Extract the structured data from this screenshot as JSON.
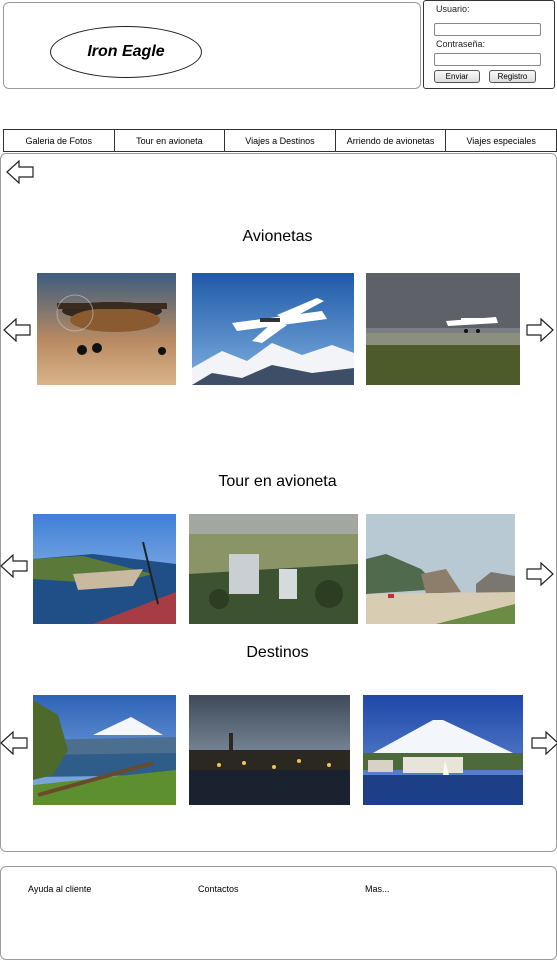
{
  "header": {
    "logo_text": "Iron Eagle"
  },
  "login": {
    "user_label": "Usuario:",
    "user_value": "",
    "password_label": "Contraseña:",
    "password_value": "",
    "submit_label": "Enviar",
    "register_label": "Registro"
  },
  "nav": {
    "items": [
      {
        "label": "Galeria de Fotos"
      },
      {
        "label": "Tour en avioneta"
      },
      {
        "label": "Viajes a Destinos"
      },
      {
        "label": "Arriendo de avionetas"
      },
      {
        "label": "Viajes especiales"
      }
    ]
  },
  "main": {
    "back_icon": "arrow-left-icon",
    "sections": [
      {
        "title": "Avionetas"
      },
      {
        "title": "Tour en avioneta"
      },
      {
        "title": "Destinos"
      }
    ]
  },
  "footer": {
    "links": [
      {
        "label": "Ayuda al cliente"
      },
      {
        "label": "Contactos"
      },
      {
        "label": "Mas..."
      }
    ]
  }
}
